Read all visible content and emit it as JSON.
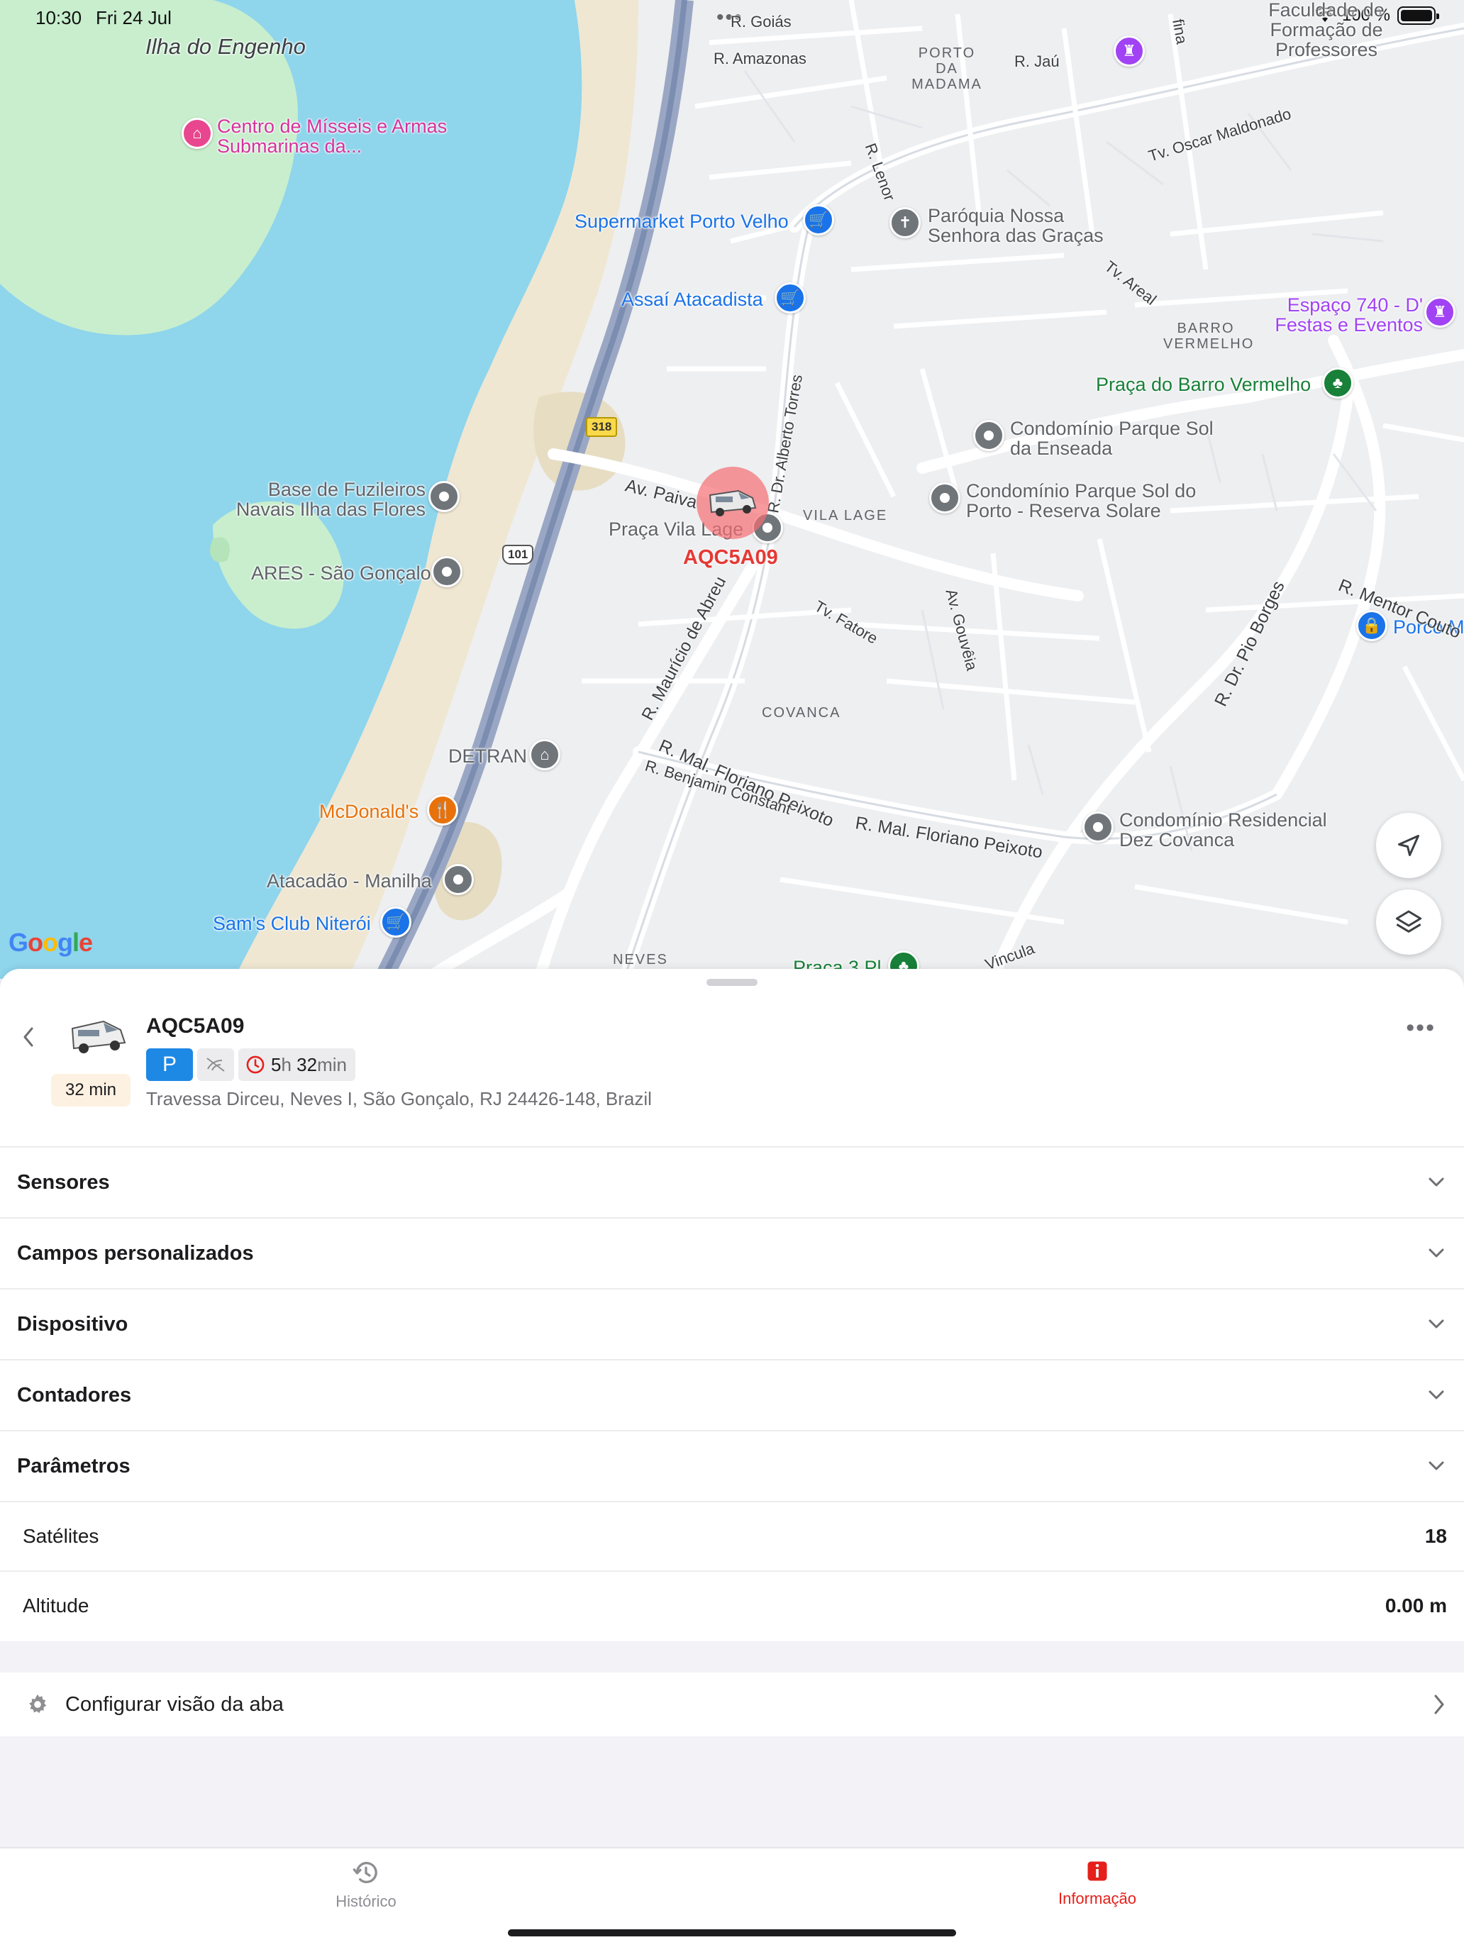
{
  "status_bar": {
    "time": "10:30",
    "date": "Fri 24 Jul",
    "battery": "100 %"
  },
  "map": {
    "island_label": "Ilha do Engenho",
    "places": {
      "centro_misseis": "Centro de Mísseis e Armas Submarinas da...",
      "supermarket": "Supermarket Porto Velho",
      "paroquia": "Paróquia Nossa Senhora das Graças",
      "assai": "Assaí Atacadista",
      "espaco_740": "Espaço 740 - D' Festas e Eventos",
      "praca_barro": "Praça do Barro Vermelho",
      "cond_enseada": "Condomínio Parque Sol da Enseada",
      "cond_porto": "Condomínio Parque Sol do Porto - Reserva Solare",
      "base_fuzileiros": "Base de Fuzileiros Navais Ilha das Flores",
      "praca_vila_lage": "Praça Vila Lage",
      "ares": "ARES - São Gonçalo",
      "porco": "Porco M",
      "detran": "DETRAN",
      "mcdonalds": "McDonald's",
      "atacadao": "Atacadão - Manilha",
      "sams_club": "Sam's Club Niterói",
      "cond_dez_covanca": "Condomínio Residencial Dez Covanca",
      "faculdade": "Faculdade de Formação de Professores",
      "praca_bottom": "Praça 3 Pl"
    },
    "streets": {
      "goias": "R. Goiás",
      "amazonas": "R. Amazonas",
      "jau": "R. Jaú",
      "lenor": "R. Lenor",
      "oscar": "Tv. Oscar Maldonado",
      "areal": "Tv. Areal",
      "alberto_torres": "R. Dr. Alberto Torres",
      "paiva": "Av. Paiva",
      "fatore": "Tv. Fatore",
      "gouveia": "Av. Gouvêia",
      "mauricio": "R. Maurício de Abreu",
      "floriano1": "R. Mal. Floriano Peixoto",
      "benjamin": "R. Benjamin Constant",
      "floriano2": "R. Mal. Floriano Peixoto",
      "pio_borges": "R. Dr. Pio Borges",
      "mentor": "R. Mentor Couto",
      "vincula": "Vincula",
      "fina": "fina"
    },
    "areas": {
      "porto_madama": "PORTO DA MADAMA",
      "barro_vermelho": "BARRO VERMELHO",
      "vila_lage": "VILA LAGE",
      "covanca": "COVANCA",
      "neves": "NEVES"
    },
    "shields": {
      "br101": "101",
      "rj318": "318"
    },
    "vehicle_label": "AQC5A09",
    "logo": "Google",
    "buttons": {
      "locate": "navigation-arrow-icon",
      "layers": "layers-icon"
    }
  },
  "detail": {
    "device_name": "AQC5A09",
    "elapsed": "32 min",
    "status_parked": "P",
    "duration": {
      "hours": "5",
      "hours_unit": "h",
      "minutes": "32",
      "minutes_unit": "min"
    },
    "address": "Travessa Dirceu, Neves I, São Gonçalo, RJ 24426-148, Brazil",
    "more": "•••"
  },
  "sections": [
    {
      "label": "Sensores"
    },
    {
      "label": "Campos personalizados"
    },
    {
      "label": "Dispositivo"
    },
    {
      "label": "Contadores"
    },
    {
      "label": "Parâmetros"
    }
  ],
  "parameters": [
    {
      "label": "Satélites",
      "value": "18"
    },
    {
      "label": "Altitude",
      "value": "0.00 m"
    }
  ],
  "config": {
    "label": "Configurar visão da aba"
  },
  "tabs": [
    {
      "label": "Histórico",
      "icon": "history-icon",
      "active": false
    },
    {
      "label": "Informação",
      "icon": "info-icon",
      "active": true
    }
  ],
  "colors": {
    "accent_red": "#e5201b",
    "parked_blue": "#1e88e5",
    "badge_bg": "#fdf1e2",
    "water": "#8fd5ec"
  }
}
